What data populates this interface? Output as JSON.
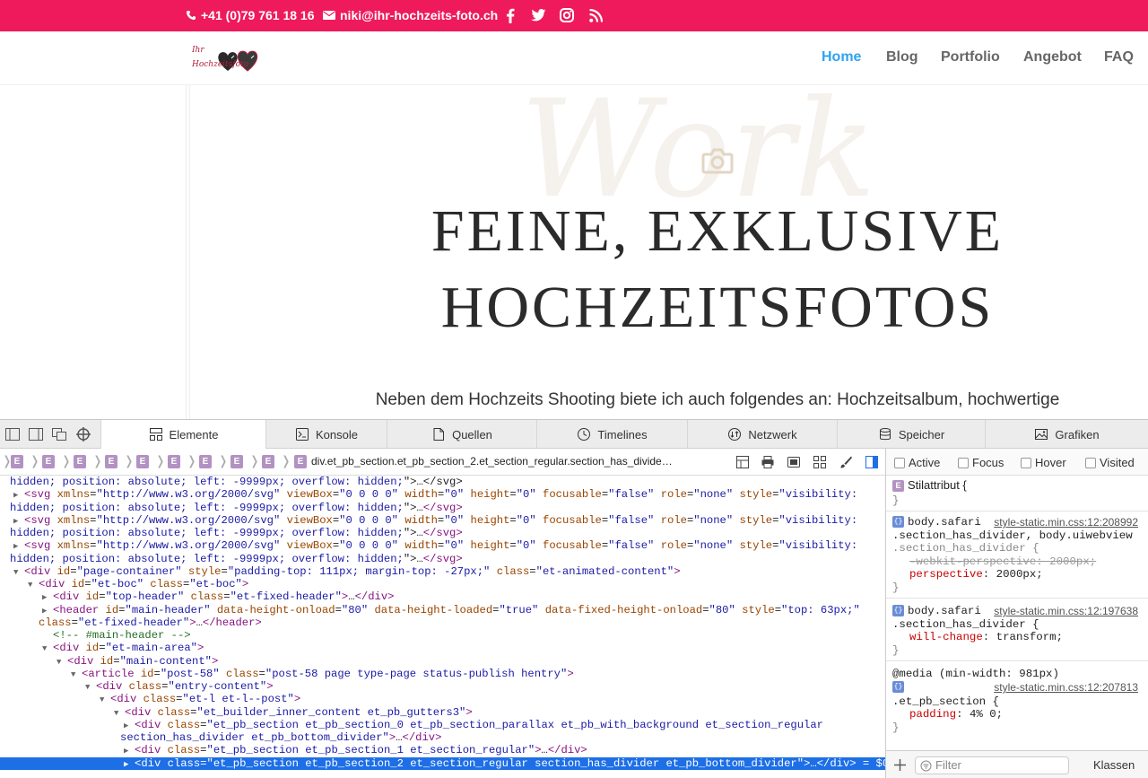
{
  "topbar": {
    "phone": "+41 (0)79 761 18 16",
    "email": "niki@ihr-hochzeits-foto.ch",
    "social_icons": [
      "facebook-icon",
      "twitter-icon",
      "instagram-icon",
      "rss-icon"
    ],
    "bg_color": "#ee1a5c"
  },
  "header": {
    "logo_text_line1": "Ihr",
    "logo_text_line2": "Hochzeitsfoto",
    "nav": [
      {
        "label": "Home",
        "active": true
      },
      {
        "label": "Blog",
        "active": false
      },
      {
        "label": "Portfolio",
        "active": false
      },
      {
        "label": "Angebot",
        "active": false
      },
      {
        "label": "FAQ",
        "active": false
      }
    ],
    "active_color": "#2ea3f2"
  },
  "hero": {
    "watermark": "Work",
    "title_line1": "FEINE, EXKLUSIVE",
    "title_line2": "HOCHZEITSFOTOS",
    "intro": "Neben dem Hochzeits Shooting biete ich auch folgendes an: Hochzeitsalbum, hochwertige"
  },
  "devtools": {
    "tabs": [
      {
        "label": "Elemente",
        "icon": "elements-icon",
        "active": true
      },
      {
        "label": "Konsole",
        "icon": "console-icon",
        "active": false
      },
      {
        "label": "Quellen",
        "icon": "sources-icon",
        "active": false
      },
      {
        "label": "Timelines",
        "icon": "timelines-icon",
        "active": false
      },
      {
        "label": "Netzwerk",
        "icon": "network-icon",
        "active": false
      },
      {
        "label": "Speicher",
        "icon": "storage-icon",
        "active": false
      },
      {
        "label": "Grafiken",
        "icon": "graphics-icon",
        "active": false
      }
    ],
    "breadcrumb_badge": "E",
    "breadcrumb_selected": "div.et_pb_section.et_pb_section_2.et_section_regular.section_has_divide…",
    "dom_lines": [
      {
        "tri": "",
        "html": "<span class='av'>hidden; position: absolute; left: -9999px; overflow: hidden;</span>\"&gt;…&lt;/svg&gt;"
      },
      {
        "tri": "▶",
        "html": "<span class='tg'>&lt;svg</span> <span class='at'>xmlns</span>=<span class='av'>\"http://www.w3.org/2000/svg\"</span> <span class='at'>viewBox</span>=<span class='av'>\"0 0 0 0\"</span> <span class='at'>width</span>=<span class='av'>\"0\"</span> <span class='at'>height</span>=<span class='av'>\"0\"</span> <span class='at'>focusable</span>=<span class='av'>\"false\"</span> <span class='at'>role</span>=<span class='av'>\"none\"</span> <span class='at'>style</span>=<span class='av'>\"visibility:</span>"
      },
      {
        "tri": "",
        "html": "<span class='av'>hidden; position: absolute; left: -9999px; overflow: hidden;</span>\"&gt;…<span class='tg'>&lt;/svg&gt;</span>"
      },
      {
        "tri": "▶",
        "html": "<span class='tg'>&lt;svg</span> <span class='at'>xmlns</span>=<span class='av'>\"http://www.w3.org/2000/svg\"</span> <span class='at'>viewBox</span>=<span class='av'>\"0 0 0 0\"</span> <span class='at'>width</span>=<span class='av'>\"0\"</span> <span class='at'>height</span>=<span class='av'>\"0\"</span> <span class='at'>focusable</span>=<span class='av'>\"false\"</span> <span class='at'>role</span>=<span class='av'>\"none\"</span> <span class='at'>style</span>=<span class='av'>\"visibility:</span>"
      },
      {
        "tri": "",
        "html": "<span class='av'>hidden; position: absolute; left: -9999px; overflow: hidden;</span>\"&gt;…<span class='tg'>&lt;/svg&gt;</span>"
      },
      {
        "tri": "▶",
        "html": "<span class='tg'>&lt;svg</span> <span class='at'>xmlns</span>=<span class='av'>\"http://www.w3.org/2000/svg\"</span> <span class='at'>viewBox</span>=<span class='av'>\"0 0 0 0\"</span> <span class='at'>width</span>=<span class='av'>\"0\"</span> <span class='at'>height</span>=<span class='av'>\"0\"</span> <span class='at'>focusable</span>=<span class='av'>\"false\"</span> <span class='at'>role</span>=<span class='av'>\"none\"</span> <span class='at'>style</span>=<span class='av'>\"visibility:</span>"
      },
      {
        "tri": "",
        "html": "<span class='av'>hidden; position: absolute; left: -9999px; overflow: hidden;</span>\"&gt;…<span class='tg'>&lt;/svg&gt;</span>"
      },
      {
        "tri": "▼",
        "html": "<span class='tg'>&lt;div</span> <span class='at'>id</span>=<span class='av'>\"page-container\"</span> <span class='at'>style</span>=<span class='av'>\"padding-top: 111px; margin-top: -27px;\"</span> <span class='at'>class</span>=<span class='av'>\"et-animated-content\"</span><span class='tg'>&gt;</span>"
      },
      {
        "tri": "▼",
        "html": "<span class='tg'>&lt;div</span> <span class='at'>id</span>=<span class='av'>\"et-boc\"</span> <span class='at'>class</span>=<span class='av'>\"et-boc\"</span><span class='tg'>&gt;</span>"
      },
      {
        "tri": "▶",
        "html": "<span class='tg'>&lt;div</span> <span class='at'>id</span>=<span class='av'>\"top-header\"</span> <span class='at'>class</span>=<span class='av'>\"et-fixed-header\"</span><span class='tg'>&gt;</span>…<span class='tg'>&lt;/div&gt;</span>"
      },
      {
        "tri": "▶",
        "html": "<span class='tg'>&lt;header</span> <span class='at'>id</span>=<span class='av'>\"main-header\"</span> <span class='at'>data-height-onload</span>=<span class='av'>\"80\"</span> <span class='at'>data-height-loaded</span>=<span class='av'>\"true\"</span> <span class='at'>data-fixed-height-onload</span>=<span class='av'>\"80\"</span> <span class='at'>style</span>=<span class='av'>\"top: 63px;\"</span>"
      },
      {
        "tri": "",
        "html": "<span class='at'>class</span>=<span class='av'>\"et-fixed-header\"</span><span class='tg'>&gt;</span>…<span class='tg'>&lt;/header&gt;</span>"
      },
      {
        "tri": "",
        "html": "<span class='cm'>&lt;!-- #main-header --&gt;</span>"
      },
      {
        "tri": "▼",
        "html": "<span class='tg'>&lt;div</span> <span class='at'>id</span>=<span class='av'>\"et-main-area\"</span><span class='tg'>&gt;</span>"
      },
      {
        "tri": "▼",
        "html": "<span class='tg'>&lt;div</span> <span class='at'>id</span>=<span class='av'>\"main-content\"</span><span class='tg'>&gt;</span>"
      },
      {
        "tri": "▼",
        "html": "<span class='tg'>&lt;article</span> <span class='at'>id</span>=<span class='av'>\"post-58\"</span> <span class='at'>class</span>=<span class='av'>\"post-58 page type-page status-publish hentry\"</span><span class='tg'>&gt;</span>"
      },
      {
        "tri": "▼",
        "html": "<span class='tg'>&lt;div</span> <span class='at'>class</span>=<span class='av'>\"entry-content\"</span><span class='tg'>&gt;</span>"
      },
      {
        "tri": "▼",
        "html": "<span class='tg'>&lt;div</span> <span class='at'>class</span>=<span class='av'>\"et-l et-l--post\"</span><span class='tg'>&gt;</span>"
      },
      {
        "tri": "▼",
        "html": "<span class='tg'>&lt;div</span> <span class='at'>class</span>=<span class='av'>\"et_builder_inner_content et_pb_gutters3\"</span><span class='tg'>&gt;</span>"
      },
      {
        "tri": "▶",
        "html": "<span class='tg'>&lt;div</span> <span class='at'>class</span>=<span class='av'>\"et_pb_section et_pb_section_0 et_pb_section_parallax et_pb_with_background et_section_regular</span>"
      },
      {
        "tri": "",
        "html": "<span class='av'>section_has_divider et_pb_bottom_divider\"</span><span class='tg'>&gt;</span>…<span class='tg'>&lt;/div&gt;</span>"
      },
      {
        "tri": "▶",
        "html": "<span class='tg'>&lt;div</span> <span class='at'>class</span>=<span class='av'>\"et_pb_section et_pb_section_1 et_section_regular\"</span><span class='tg'>&gt;</span>…<span class='tg'>&lt;/div&gt;</span>"
      },
      {
        "tri": "▶",
        "html": "<span class='tg'>&lt;div</span> <span class='at'>class</span>=<span class='av'>\"et_pb_section et_pb_section_2 et_section_regular section_has_divider et_pb_bottom_divider\"</span><span class='tg'>&gt;</span>…<span class='tg'>&lt;/div&gt;</span> = $0",
        "selected": true
      }
    ],
    "pseudo_classes": [
      "Active",
      "Focus",
      "Hover",
      "Visited"
    ],
    "style_attr_label": "Stilattribut {",
    "style_attr_close": "}",
    "rules": [
      {
        "selector1": "body.safari",
        "selector2": ".section_has_divider, body.uiwebview",
        "selector3": ".section_has_divider {",
        "source": "style-static.min.css:12:208992",
        "props": [
          {
            "name": "-webkit-perspective",
            "value": "2000px;",
            "struck": true
          },
          {
            "name": "perspective",
            "value": "2000px;",
            "struck": false
          }
        ]
      },
      {
        "selector1": "body.safari",
        "selector2": ".section_has_divider {",
        "source": "style-static.min.css:12:197638",
        "props": [
          {
            "name": "will-change",
            "value": "transform;",
            "struck": false
          }
        ]
      },
      {
        "media": "@media (min-width: 981px)",
        "selector1": ".et_pb_section {",
        "source": "style-static.min.css:12:207813",
        "props": [
          {
            "name": "padding",
            "value": "4% 0;",
            "struck": false
          }
        ]
      }
    ],
    "filter_placeholder": "Filter",
    "classes_button": "Klassen"
  }
}
